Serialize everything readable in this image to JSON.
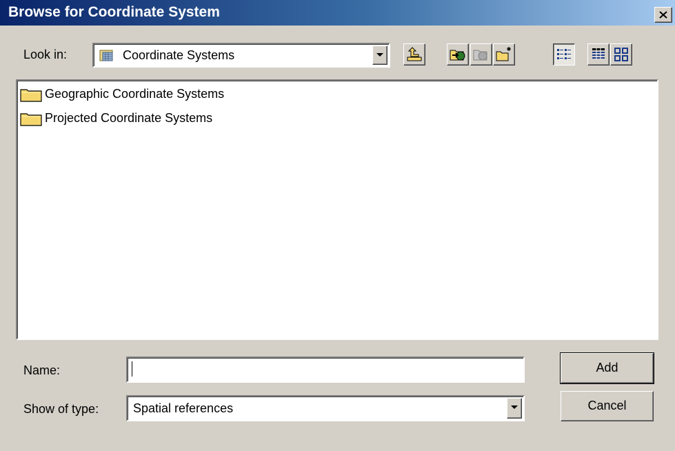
{
  "window": {
    "title": "Browse for Coordinate System"
  },
  "look_in": {
    "label": "Look in:",
    "value": "Coordinate Systems"
  },
  "toolbar": {
    "buttons": [
      {
        "name": "up-one-level",
        "icon": "up-folder-icon"
      },
      {
        "name": "connect-to-folder",
        "icon": "connect-folder-icon"
      },
      {
        "name": "disconnect-from-folder",
        "icon": "disconnect-folder-icon"
      },
      {
        "name": "new-folder",
        "icon": "new-folder-icon"
      },
      {
        "name": "list-view",
        "icon": "list-view-icon",
        "pressed": true
      },
      {
        "name": "details-view",
        "icon": "details-view-icon"
      },
      {
        "name": "thumbnails-view",
        "icon": "thumbnails-view-icon"
      }
    ]
  },
  "file_list": {
    "items": [
      {
        "label": "Geographic Coordinate Systems",
        "icon": "folder-icon"
      },
      {
        "label": "Projected Coordinate Systems",
        "icon": "folder-icon"
      }
    ]
  },
  "name_field": {
    "label": "Name:",
    "value": ""
  },
  "type_field": {
    "label": "Show of type:",
    "value": "Spatial references"
  },
  "buttons": {
    "add_label": "Add",
    "cancel_label": "Cancel"
  },
  "colors": {
    "title_start": "#0a246a",
    "title_end": "#a6caf0",
    "face": "#d4d0c8",
    "folder": "#f5d76e"
  }
}
